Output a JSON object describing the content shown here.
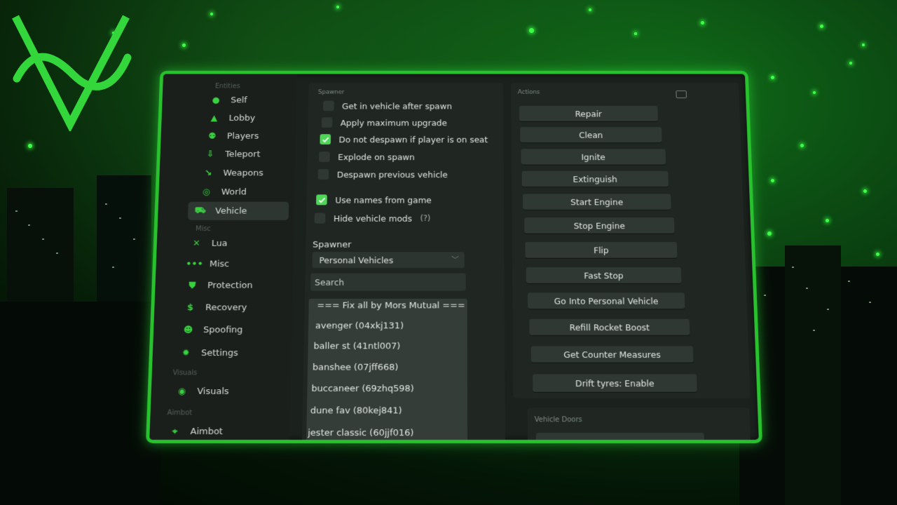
{
  "sidebar": {
    "sections": {
      "entities": "Entities",
      "misc": "Misc",
      "visuals": "Visuals",
      "aimbot": "Aimbot"
    },
    "items": [
      {
        "label": "Self",
        "icon": "person-icon"
      },
      {
        "label": "Lobby",
        "icon": "hat-icon"
      },
      {
        "label": "Players",
        "icon": "users-icon"
      },
      {
        "label": "Teleport",
        "icon": "teleport-icon"
      },
      {
        "label": "Weapons",
        "icon": "gun-icon"
      },
      {
        "label": "World",
        "icon": "globe-icon"
      },
      {
        "label": "Vehicle",
        "icon": "car-icon",
        "active": true
      },
      {
        "label": "Lua",
        "icon": "tools-icon"
      },
      {
        "label": "Misc",
        "icon": "dots-icon"
      },
      {
        "label": "Protection",
        "icon": "shield-icon"
      },
      {
        "label": "Recovery",
        "icon": "dollar-icon"
      },
      {
        "label": "Spoofing",
        "icon": "mask-icon"
      },
      {
        "label": "Settings",
        "icon": "gear-icon"
      },
      {
        "label": "Visuals",
        "icon": "eye-icon"
      },
      {
        "label": "Aimbot",
        "icon": "crosshair-icon"
      }
    ]
  },
  "spawner_panel": {
    "title": "Spawner",
    "checkboxes": [
      {
        "label": "Get in vehicle after spawn",
        "checked": false
      },
      {
        "label": "Apply maximum upgrade",
        "checked": false
      },
      {
        "label": "Do not despawn if player is on seat",
        "checked": true
      },
      {
        "label": "Explode on spawn",
        "checked": false
      },
      {
        "label": "Despawn previous vehicle",
        "checked": false
      },
      {
        "label": "Use names from game",
        "checked": true
      },
      {
        "label": "Hide vehicle mods",
        "checked": false
      }
    ],
    "help_mark": "(?)",
    "spawner_label": "Spawner",
    "select_value": "Personal Vehicles",
    "search_placeholder": "Search",
    "vehicles": [
      "=== Fix all by Mors Mutual ===",
      "avenger (04xkj131)",
      "baller st (41ntl007)",
      "banshee (07jff668)",
      "buccaneer (69zhq598)",
      "dune fav (80kej841)",
      "jester classic (60jjf016)"
    ]
  },
  "actions_panel": {
    "title": "Actions",
    "buttons": [
      "Repair",
      "Clean",
      "Ignite",
      "Extinguish",
      "Start Engine",
      "Stop Engine",
      "Flip",
      "Fast Stop",
      "Go Into Personal Vehicle",
      "Refill Rocket Boost",
      "Get Counter Measures",
      "Drift tyres: Enable"
    ]
  },
  "doors_panel": {
    "title": "Vehicle Doors"
  },
  "colors": {
    "accent": "#29c22f",
    "panel_bg": "#1b211d",
    "checkbox_on": "#4ed657"
  }
}
